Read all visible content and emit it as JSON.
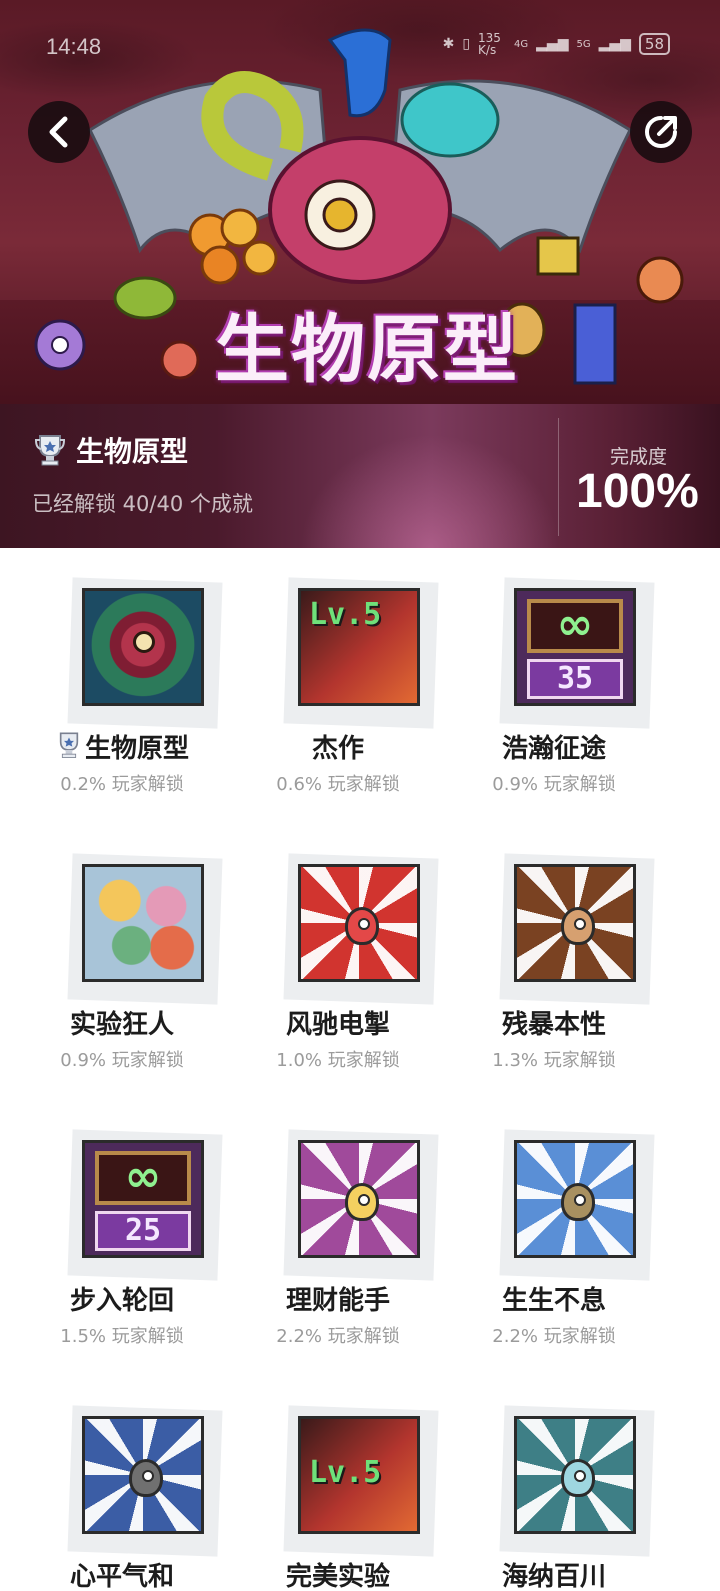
{
  "status_bar": {
    "time": "14:48",
    "net_speed": "135 K/s",
    "signal_1": "4G",
    "signal_2": "5G",
    "battery": "58"
  },
  "header": {
    "banner_title": "生物原型",
    "back_icon": "chevron-left-icon",
    "share_icon": "share-icon"
  },
  "summary": {
    "name": "生物原型",
    "unlocked_text": "已经解锁 40/40 个成就",
    "completion_label": "完成度",
    "completion_value": "100%"
  },
  "achievements": [
    {
      "name": "生物原型",
      "rate": "0.2% 玩家解锁",
      "trophy": true,
      "art": "creature"
    },
    {
      "name": "杰作",
      "rate": "0.6% 玩家解锁",
      "art": "lv5"
    },
    {
      "name": "浩瀚征途",
      "rate": "0.9% 玩家解锁",
      "art": "inf35"
    },
    {
      "name": "实验狂人",
      "rate": "0.9% 玩家解锁",
      "art": "eggs"
    },
    {
      "name": "风驰电掣",
      "rate": "1.0% 玩家解锁",
      "art": "burst-red"
    },
    {
      "name": "残暴本性",
      "rate": "1.3% 玩家解锁",
      "art": "burst-brown"
    },
    {
      "name": "步入轮回",
      "rate": "1.5% 玩家解锁",
      "art": "inf25"
    },
    {
      "name": "理财能手",
      "rate": "2.2% 玩家解锁",
      "art": "burst-gold"
    },
    {
      "name": "生生不息",
      "rate": "2.2% 玩家解锁",
      "art": "burst-rainbow"
    },
    {
      "name": "心平气和",
      "rate": "",
      "art": "burst-blue"
    },
    {
      "name": "完美实验",
      "rate": "",
      "art": "lv5-red"
    },
    {
      "name": "海纳百川",
      "rate": "",
      "art": "burst-teal"
    }
  ],
  "colors": {
    "accent": "#ffffff",
    "title_text": "#1c1c1c",
    "rate_text": "#9b9b9b"
  }
}
